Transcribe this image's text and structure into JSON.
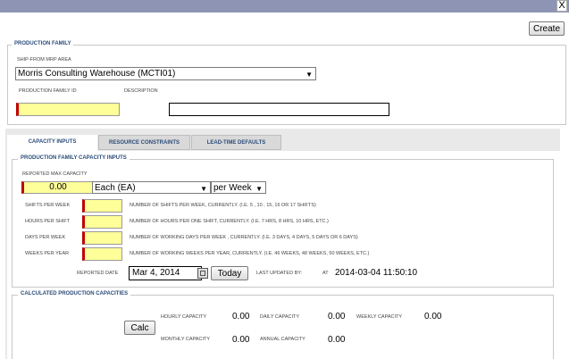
{
  "window": {
    "close_glyph": "X"
  },
  "toolbar": {
    "create_label": "Create"
  },
  "production_family": {
    "legend": "PRODUCTION FAMILY",
    "ship_from_label": "SHIP-FROM MRP AREA",
    "ship_from_value": "Morris Consulting Warehouse (MCTI01)",
    "family_id_label": "PRODUCTION FAMILY ID",
    "description_label": "DESCRIPTION"
  },
  "tabs": [
    {
      "label": "CAPACITY INPUTS"
    },
    {
      "label": "RESOURCE CONSTRAINTS"
    },
    {
      "label": "LEAD-TIME DEFAULTS"
    }
  ],
  "capacity_inputs": {
    "legend": "PRODUCTION FAMILY CAPACITY INPUTS",
    "reported_max_label": "REPORTED MAX CAPACITY",
    "reported_max_value": "0.00",
    "uom_value": "Each (EA)",
    "period_value": "per Week",
    "rows": [
      {
        "label": "SHIFTS PER WEEK",
        "help": "NUMBER OF SHIFTS PER WEEK, CURRENTLY. (I.E. 5 , 10 , 15, 16 OR 17 SHIFTS)"
      },
      {
        "label": "HOURS PER SHIFT",
        "help": "NUMBER OF HOURS PER ONE SHIFT, CURRENTLY. (I.E. 7 HRS, 8 HRS, 10 HRS, ETC.)"
      },
      {
        "label": "DAYS PER WEEK",
        "help": "NUMBER OF WORKING DAYS PER WEEK , CURRENTLY. (I.E. 3 DAYS, 4 DAYS, 5 DAYS OR 6 DAYS)"
      },
      {
        "label": "WEEKS PER YEAR",
        "help": "NUMBER OF WORKING WEEKS PER YEAR, CURRENTLY. (I.E. 46 WEEKS, 48 WEEKS, 50 WEEKS, ETC.)"
      }
    ],
    "reported_date_label": "REPORTED DATE",
    "reported_date_value": "Mar 4, 2014",
    "today_label": "Today",
    "last_updated_label": "LAST UPDATED BY:",
    "at_label": "AT",
    "last_updated_value": "2014-03-04 11:50:10"
  },
  "calculated": {
    "legend": "CALCULATED PRODUCTION CAPACITIES",
    "calc_label": "Calc",
    "hourly_label": "HOURLY CAPACITY",
    "hourly_value": "0.00",
    "daily_label": "DAILY CAPACITY",
    "daily_value": "0.00",
    "weekly_label": "WEEKLY CAPACITY",
    "weekly_value": "0.00",
    "monthly_label": "MONTHLY CAPACITY",
    "monthly_value": "0.00",
    "annual_label": "ANNUAL CAPACITY",
    "annual_value": "0.00"
  }
}
